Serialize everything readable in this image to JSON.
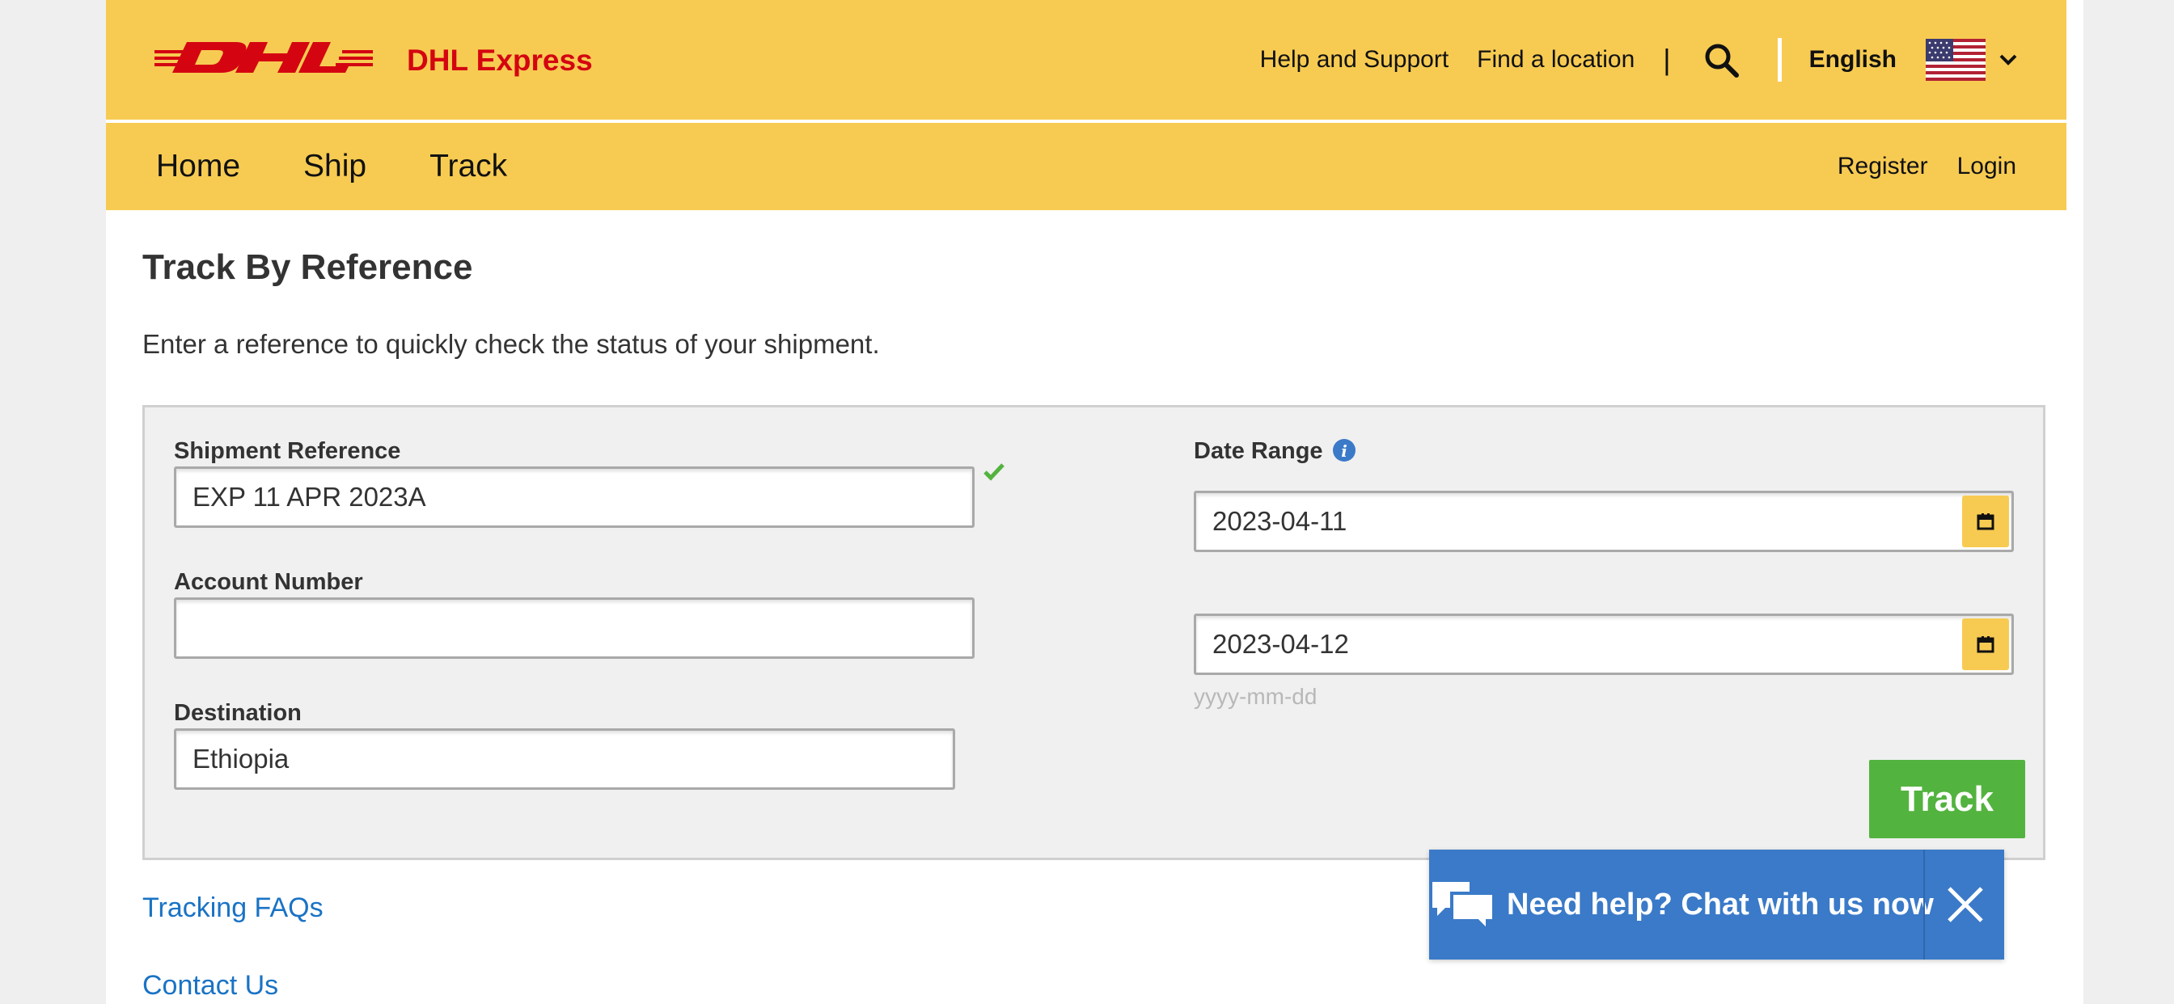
{
  "header": {
    "brand_text": "DHL Express",
    "top_links": [
      "Help and Support",
      "Find a location"
    ],
    "pipe": "|",
    "language": "English"
  },
  "nav": {
    "items": [
      "Home",
      "Ship",
      "Track"
    ],
    "right": [
      "Register",
      "Login"
    ]
  },
  "main": {
    "title": "Track By Reference",
    "subtitle": "Enter a reference to quickly check the status of your shipment."
  },
  "form": {
    "shipment_reference": {
      "label": "Shipment Reference",
      "value": "EXP 11 APR 2023A"
    },
    "account_number": {
      "label": "Account Number",
      "value": ""
    },
    "destination": {
      "label": "Destination",
      "value": "Ethiopia"
    },
    "date_range": {
      "label": "Date Range",
      "from": "2023-04-11",
      "to": "2023-04-12",
      "hint": "yyyy-mm-dd"
    },
    "track_button": "Track"
  },
  "links": [
    "Tracking FAQs",
    "Contact Us"
  ],
  "chat": {
    "text": "Need help? Chat with us now"
  },
  "colors": {
    "brand_yellow": "#f7cb52",
    "brand_red": "#d40511",
    "track_green": "#53b33f",
    "chat_blue": "#3a7ac8",
    "link_blue": "#1a73c4"
  }
}
